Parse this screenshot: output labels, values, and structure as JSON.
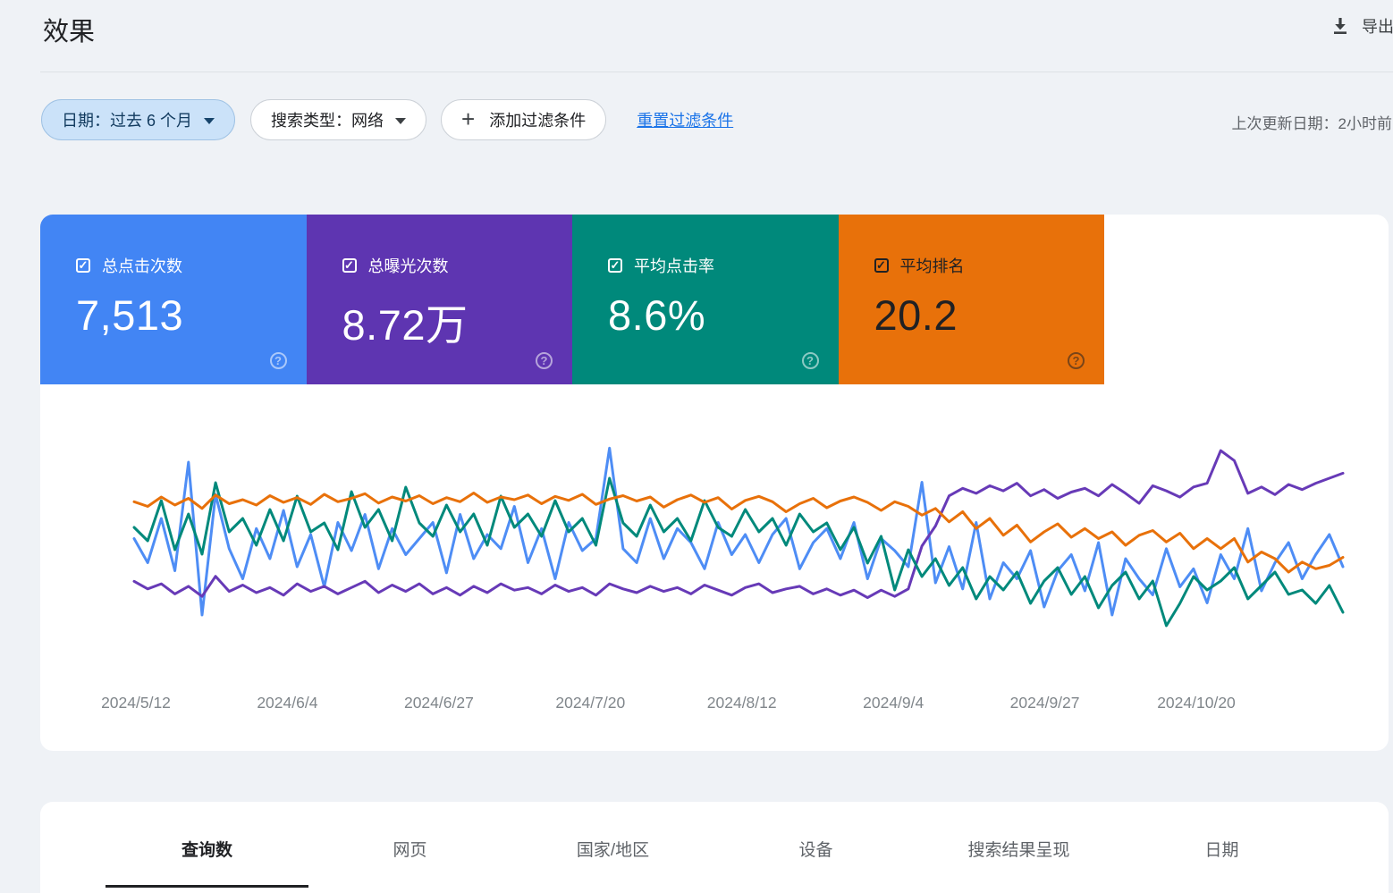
{
  "header": {
    "title": "效果",
    "export_label": "导出"
  },
  "filters": {
    "date_chip": "日期：过去 6 个月",
    "search_type_chip": "搜索类型：网络",
    "add_filter_chip": "添加过滤条件",
    "reset_link": "重置过滤条件",
    "last_updated": "上次更新日期：2小时前"
  },
  "metrics": [
    {
      "label": "总点击次数",
      "value": "7,513",
      "color": "#4285f4",
      "text_color": "#ffffff",
      "checked": true
    },
    {
      "label": "总曝光次数",
      "value": "8.72万",
      "color": "#5e35b1",
      "text_color": "#ffffff",
      "checked": true
    },
    {
      "label": "平均点击率",
      "value": "8.6%",
      "color": "#00897b",
      "text_color": "#ffffff",
      "checked": true
    },
    {
      "label": "平均排名",
      "value": "20.2",
      "color": "#e8710a",
      "text_color": "#202124",
      "checked": true
    }
  ],
  "tabs": [
    {
      "label": "查询数",
      "active": true
    },
    {
      "label": "网页",
      "active": false
    },
    {
      "label": "国家/地区",
      "active": false
    },
    {
      "label": "设备",
      "active": false
    },
    {
      "label": "搜索结果呈现",
      "active": false
    },
    {
      "label": "日期",
      "active": false
    }
  ],
  "chart_data": {
    "type": "line",
    "title": "",
    "xlabel": "",
    "ylabel": "",
    "grid": false,
    "y_axis": "hidden",
    "legend_position": "none",
    "x_tick_labels": [
      "2024/5/12",
      "2024/6/4",
      "2024/6/27",
      "2024/7/20",
      "2024/8/12",
      "2024/9/4",
      "2024/9/27",
      "2024/10/20"
    ],
    "series": [
      {
        "name": "总点击次数",
        "unit": "clicks/day",
        "color": "#4e8df5",
        "range": [
          0,
          100
        ],
        "inverted": false,
        "values": [
          50,
          38,
          60,
          34,
          88,
          12,
          72,
          45,
          30,
          55,
          40,
          64,
          36,
          52,
          26,
          58,
          44,
          62,
          35,
          55,
          42,
          50,
          58,
          33,
          62,
          40,
          52,
          45,
          66,
          38,
          55,
          30,
          58,
          44,
          50,
          95,
          45,
          38,
          60,
          40,
          55,
          48,
          35,
          58,
          42,
          52,
          38,
          52,
          60,
          35,
          48,
          55,
          40,
          58,
          30,
          50,
          44,
          36,
          78,
          28,
          46,
          25,
          58,
          20,
          38,
          30,
          44,
          16,
          34,
          42,
          24,
          48,
          12,
          40,
          30,
          22,
          45,
          26,
          35,
          18,
          42,
          30,
          55,
          24,
          38,
          48,
          30,
          42,
          52,
          36
        ]
      },
      {
        "name": "总曝光次数",
        "unit": "impressions/day",
        "color": "#673ab7",
        "range": [
          250,
          1050
        ],
        "inverted": false,
        "values": [
          480,
          450,
          470,
          430,
          460,
          420,
          500,
          440,
          465,
          435,
          455,
          425,
          470,
          440,
          460,
          430,
          455,
          480,
          435,
          465,
          440,
          470,
          430,
          455,
          425,
          460,
          435,
          470,
          445,
          455,
          430,
          465,
          440,
          455,
          425,
          470,
          450,
          435,
          460,
          440,
          455,
          430,
          465,
          445,
          425,
          455,
          470,
          435,
          450,
          460,
          430,
          450,
          425,
          445,
          415,
          445,
          420,
          450,
          620,
          700,
          820,
          850,
          830,
          860,
          840,
          870,
          820,
          845,
          810,
          835,
          850,
          820,
          865,
          830,
          790,
          860,
          840,
          815,
          855,
          870,
          1000,
          960,
          830,
          855,
          825,
          865,
          845,
          870,
          890,
          910
        ]
      },
      {
        "name": "平均点击率",
        "unit": "%",
        "color": "#00897b",
        "range": [
          4,
          13
        ],
        "inverted": false,
        "values": [
          9.0,
          8.4,
          10.2,
          8.0,
          9.6,
          7.8,
          11.0,
          8.8,
          9.4,
          8.2,
          9.8,
          8.4,
          10.4,
          8.8,
          9.2,
          8.0,
          10.6,
          9.0,
          9.8,
          8.4,
          10.8,
          9.2,
          8.6,
          10.0,
          8.8,
          9.6,
          8.2,
          10.4,
          9.0,
          9.6,
          8.6,
          10.2,
          8.8,
          9.4,
          8.2,
          11.2,
          9.2,
          8.6,
          10.0,
          8.8,
          9.4,
          8.4,
          10.2,
          9.0,
          8.6,
          9.8,
          8.8,
          9.4,
          8.2,
          9.6,
          8.8,
          9.2,
          8.0,
          9.0,
          7.4,
          8.6,
          6.2,
          8.0,
          6.8,
          7.6,
          6.4,
          7.2,
          5.8,
          6.8,
          6.2,
          7.0,
          5.6,
          6.6,
          7.2,
          6.0,
          6.8,
          5.4,
          6.4,
          7.0,
          5.8,
          6.6,
          4.6,
          5.6,
          6.8,
          6.2,
          6.6,
          7.2,
          5.8,
          6.4,
          7.0,
          6.0,
          6.2,
          5.6,
          6.4,
          5.2
        ]
      },
      {
        "name": "平均排名",
        "unit": "position",
        "color": "#e8710a",
        "range": [
          10,
          40
        ],
        "inverted": true,
        "values": [
          19.5,
          20.2,
          18.8,
          20.0,
          19.0,
          20.5,
          18.5,
          19.8,
          19.2,
          20.0,
          18.6,
          19.6,
          18.9,
          19.9,
          18.4,
          19.5,
          19.0,
          18.3,
          19.7,
          18.8,
          19.4,
          18.6,
          19.8,
          18.9,
          19.5,
          18.2,
          19.6,
          18.8,
          19.2,
          18.5,
          19.8,
          18.7,
          19.3,
          18.4,
          19.9,
          19.1,
          18.6,
          19.4,
          18.8,
          20.3,
          19.2,
          18.5,
          19.6,
          18.9,
          20.6,
          19.3,
          18.7,
          19.5,
          21.0,
          19.8,
          19.0,
          20.4,
          19.4,
          18.8,
          19.6,
          20.8,
          19.5,
          20.2,
          21.5,
          20.5,
          22.5,
          21.0,
          23.5,
          22.0,
          24.5,
          23.0,
          25.5,
          24.0,
          22.8,
          24.8,
          23.5,
          25.0,
          24.0,
          26.0,
          24.5,
          23.8,
          25.5,
          24.2,
          26.5,
          25.0,
          26.5,
          25.0,
          28.5,
          27.0,
          28.0,
          30.0,
          28.5,
          29.5,
          29.0,
          27.8
        ]
      }
    ]
  }
}
